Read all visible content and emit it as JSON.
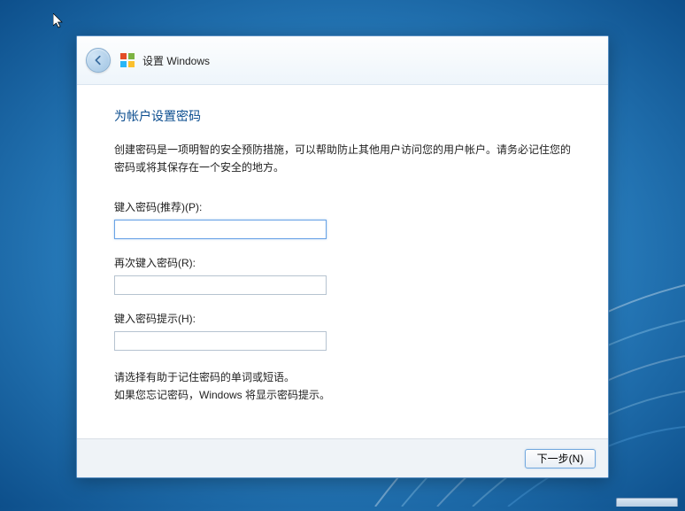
{
  "header": {
    "title": "设置 Windows"
  },
  "page": {
    "title": "为帐户设置密码",
    "description": "创建密码是一项明智的安全预防措施，可以帮助防止其他用户访问您的用户帐户。请务必记住您的密码或将其保存在一个安全的地方。"
  },
  "fields": {
    "password": {
      "label": "键入密码(推荐)(P):",
      "value": ""
    },
    "confirm": {
      "label": "再次键入密码(R):",
      "value": ""
    },
    "hint": {
      "label": "键入密码提示(H):",
      "value": ""
    }
  },
  "hint_block": {
    "line1": "请选择有助于记住密码的单词或短语。",
    "line2": "如果您忘记密码，Windows 将显示密码提示。"
  },
  "footer": {
    "next": "下一步(N)"
  }
}
